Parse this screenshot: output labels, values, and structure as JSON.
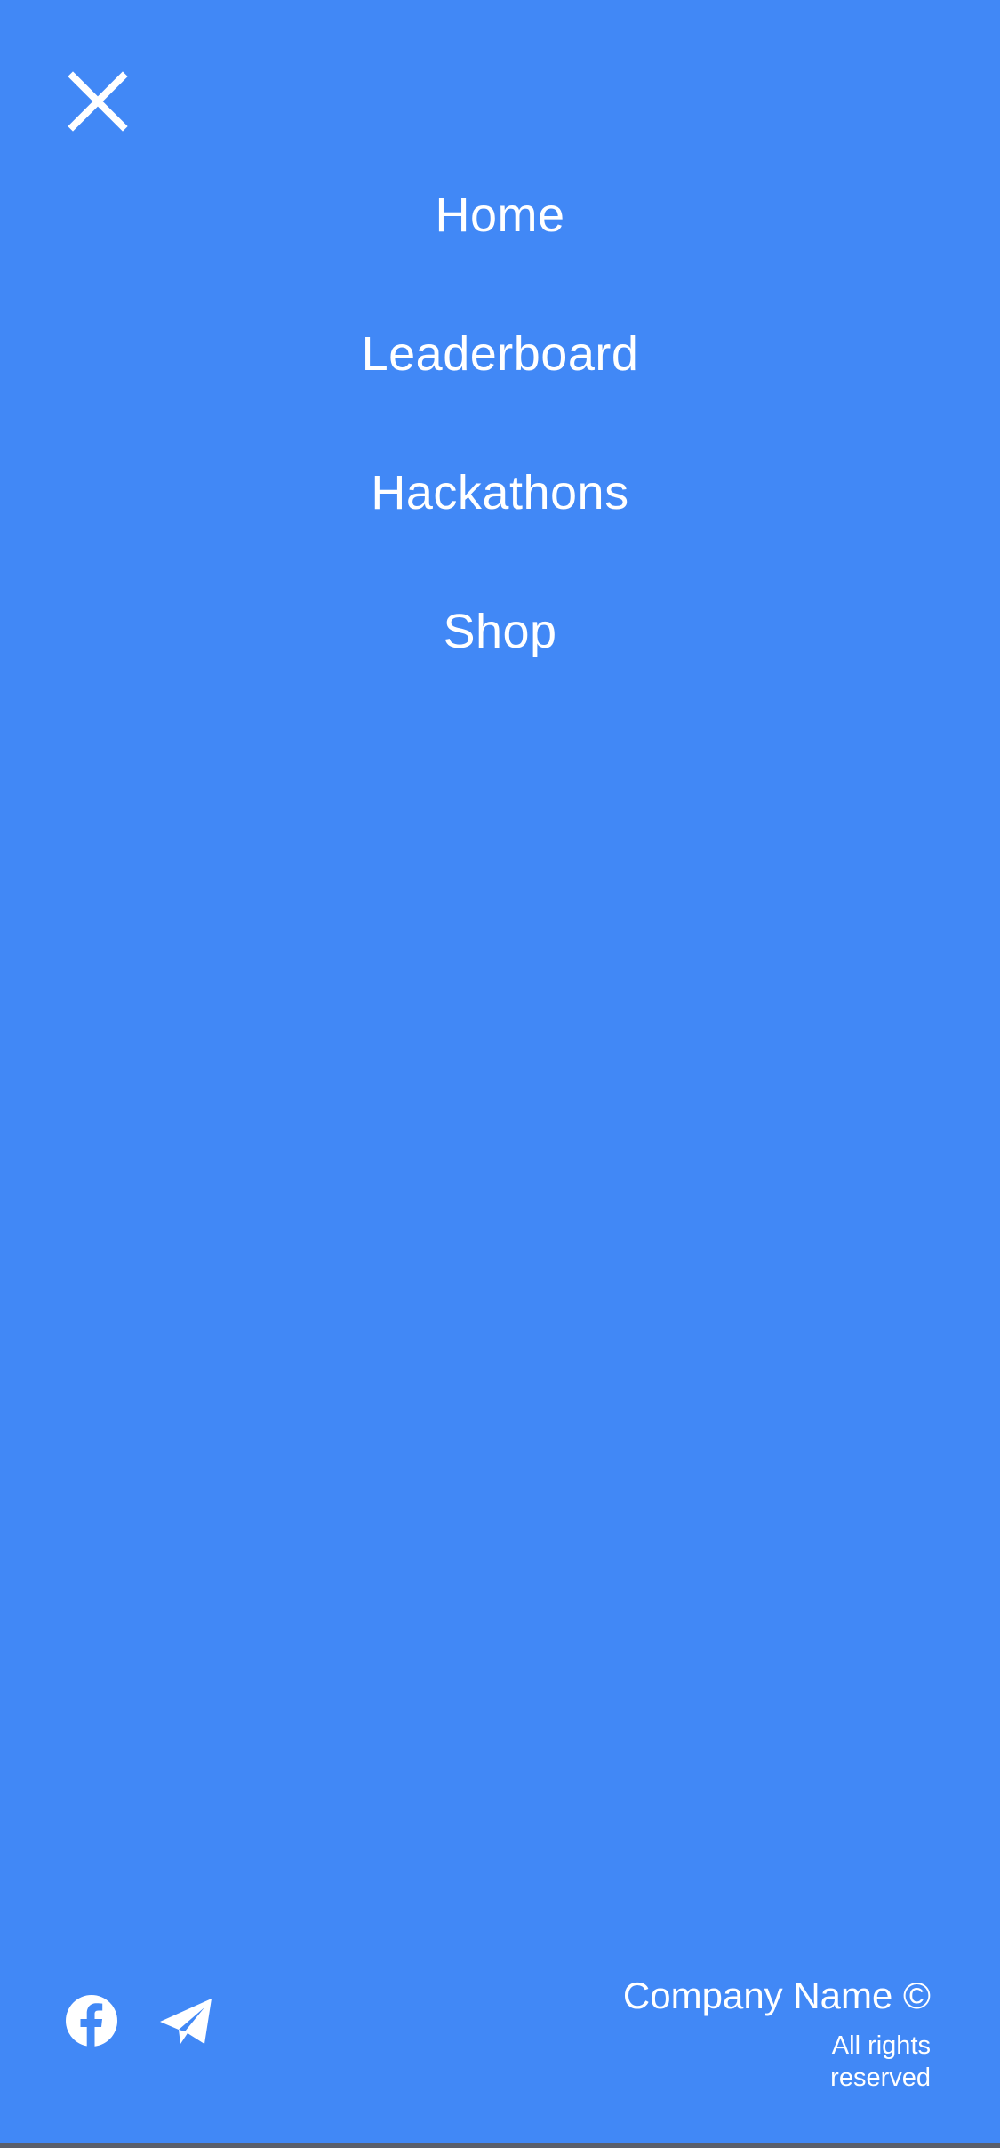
{
  "theme": {
    "background": "#4188F6",
    "foreground": "#FFFFFF"
  },
  "header": {
    "close_icon": "close-icon"
  },
  "menu": {
    "items": [
      {
        "label": "Home"
      },
      {
        "label": "Leaderboard"
      },
      {
        "label": "Hackathons"
      },
      {
        "label": "Shop"
      }
    ]
  },
  "footer": {
    "social": [
      {
        "icon": "facebook-icon"
      },
      {
        "icon": "telegram-icon"
      }
    ],
    "company": "Company Name ©",
    "rights": "All rights reserved"
  }
}
